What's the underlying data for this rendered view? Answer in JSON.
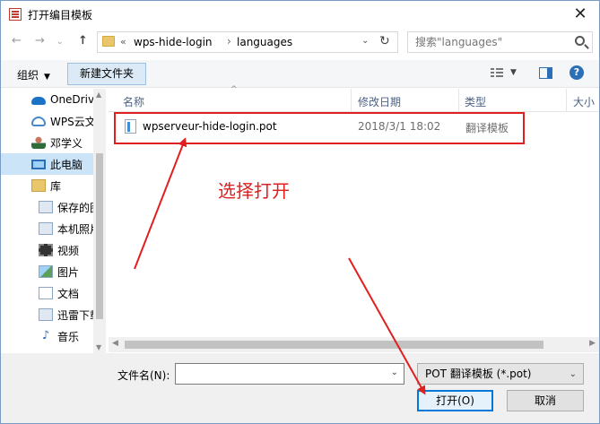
{
  "window": {
    "title": "打开编目模板",
    "close_glyph": "✕"
  },
  "nav": {
    "back_glyph": "←",
    "forward_glyph": "→",
    "recent_glyph": "⌄",
    "up_glyph": "↑",
    "path_overflow": "«",
    "breadcrumb": [
      "wps-hide-login",
      "languages"
    ],
    "breadcrumb_sep": "›",
    "dropdown_glyph": "⌄",
    "refresh_glyph": "↻"
  },
  "search": {
    "placeholder": "搜索\"languages\""
  },
  "toolbar": {
    "organize_label": "组织",
    "organize_caret": "▼",
    "new_folder_label": "新建文件夹",
    "view_caret": "▼",
    "help_glyph": "?"
  },
  "sidebar": {
    "items": [
      {
        "label": "OneDrive",
        "icon": "cloud-icon"
      },
      {
        "label": "WPS云文档",
        "icon": "wps-cloud-icon"
      },
      {
        "label": "邓学义",
        "icon": "user-icon"
      },
      {
        "label": "此电脑",
        "icon": "computer-icon"
      },
      {
        "label": "库",
        "icon": "library-icon"
      },
      {
        "label": "保存的图片",
        "icon": "saved-pictures-icon"
      },
      {
        "label": "本机照片",
        "icon": "camera-roll-icon"
      },
      {
        "label": "视频",
        "icon": "video-icon"
      },
      {
        "label": "图片",
        "icon": "pictures-icon"
      },
      {
        "label": "文档",
        "icon": "documents-icon"
      },
      {
        "label": "迅雷下载",
        "icon": "downloads-icon"
      },
      {
        "label": "音乐",
        "icon": "music-icon"
      }
    ]
  },
  "columns": {
    "name": "名称",
    "modified": "修改日期",
    "type": "类型",
    "size": "大小",
    "sort_glyph": "^"
  },
  "files": [
    {
      "name": "wpserveur-hide-login.pot",
      "modified": "2018/3/1 18:02",
      "type": "翻译模板"
    }
  ],
  "annotation": {
    "text": "选择打开",
    "color": "#e02020"
  },
  "scroll": {
    "up": "▲",
    "down": "▼",
    "left": "◀",
    "right": "▶"
  },
  "footer": {
    "filename_label": "文件名(N):",
    "filename_value": "",
    "filename_caret": "⌄",
    "filter_value": "POT 翻译模板 (*.pot)",
    "filter_caret": "⌄",
    "open_label": "打开(O)",
    "cancel_label": "取消"
  },
  "colors": {
    "accent": "#0078d7",
    "selection": "#cce4f7",
    "annotation": "#e02020"
  }
}
